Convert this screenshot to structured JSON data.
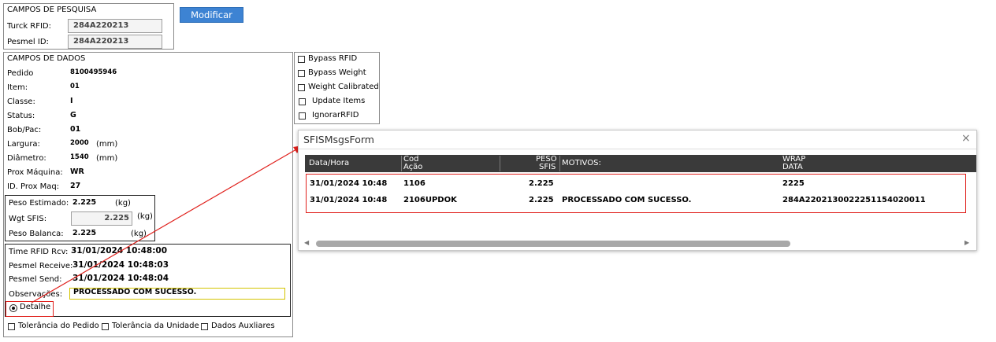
{
  "search": {
    "title": "CAMPOS DE PESQUISA",
    "turck_label": "Turck RFID:",
    "turck_value": "284A220213",
    "pesmel_label": "Pesmel ID:",
    "pesmel_value": "284A220213",
    "modify_button": "Modificar"
  },
  "data_fields": {
    "title": "CAMPOS DE DADOS",
    "pedido_label": "Pedido",
    "pedido_value": "8100495946",
    "item_label": "Item:",
    "item_value": "01",
    "classe_label": "Classe:",
    "classe_value": "I",
    "status_label": "Status:",
    "status_value": "G",
    "bobpac_label": "Bob/Pac:",
    "bobpac_value": "01",
    "largura_label": "Largura:",
    "largura_value": "2000",
    "largura_unit": "(mm)",
    "diametro_label": "Diâmetro:",
    "diametro_value": "1540",
    "diametro_unit": "(mm)",
    "prox_maquina_label": "Prox Máquina:",
    "prox_maquina_value": "WR",
    "id_prox_maq_label": "ID. Prox Maq:",
    "id_prox_maq_value": "27"
  },
  "weights": {
    "estimado_label": "Peso Estimado:",
    "estimado_value": "2.225",
    "estimado_unit": "(kg)",
    "sfis_label": "Wgt SFIS:",
    "sfis_value": "2.225",
    "sfis_unit": "(kg)",
    "balanca_label": "Peso Balanca:",
    "balanca_value": "2.225",
    "balanca_unit": "(kg)"
  },
  "times": {
    "rfid_rcv_label": "Time RFID Rcv:",
    "rfid_rcv_value": "31/01/2024 10:48:00",
    "pesmel_receive_label": "Pesmel Receive:",
    "pesmel_receive_value": "31/01/2024 10:48:03",
    "pesmel_send_label": "Pesmel Send:",
    "pesmel_send_value": "31/01/2024 10:48:04",
    "observacoes_label": "Observações:",
    "observacoes_value": "PROCESSADO COM SUCESSO.",
    "detalhe_label": "Detalhe"
  },
  "footer_checks": {
    "tolerancia_pedido": "Tolerância do Pedido",
    "tolerancia_unidade": "Tolerância da Unidade",
    "dados_auxiliares": "Dados Auxliares"
  },
  "options": {
    "bypass_rfid": "Bypass RFID",
    "bypass_weight": "Bypass Weight",
    "weight_calibrated": "Weight Calibrated",
    "update_items": "Update Items",
    "ignorar_rfid": "IgnorarRFID"
  },
  "dialog": {
    "title": "SFISMsgsForm",
    "close_glyph": "×",
    "columns": {
      "data_hora": "Data/Hora",
      "cod_1": "Cod",
      "cod_2": "Ação",
      "peso_1": "PESO",
      "peso_2": "SFIS",
      "motivos": "MOTIVOS:",
      "wrap_1": "WRAP",
      "wrap_2": "DATA"
    },
    "rows": [
      {
        "data_hora": "31/01/2024 10:48",
        "cod": "1106",
        "peso": "2.225",
        "motivos": "",
        "wrap": "2225"
      },
      {
        "data_hora": "31/01/2024 10:48",
        "cod": "2106UPDOK",
        "peso": "2.225",
        "motivos": "PROCESSADO COM SUCESSO.",
        "wrap": "284A2202130022251154020011"
      }
    ],
    "scroll_left_glyph": "◀",
    "scroll_right_glyph": "▶"
  },
  "colors": {
    "accent_blue": "#3d83d3",
    "highlight_red": "#e0201c",
    "grid_header": "#3a3a3a",
    "observacoes_border": "#d4c400"
  }
}
